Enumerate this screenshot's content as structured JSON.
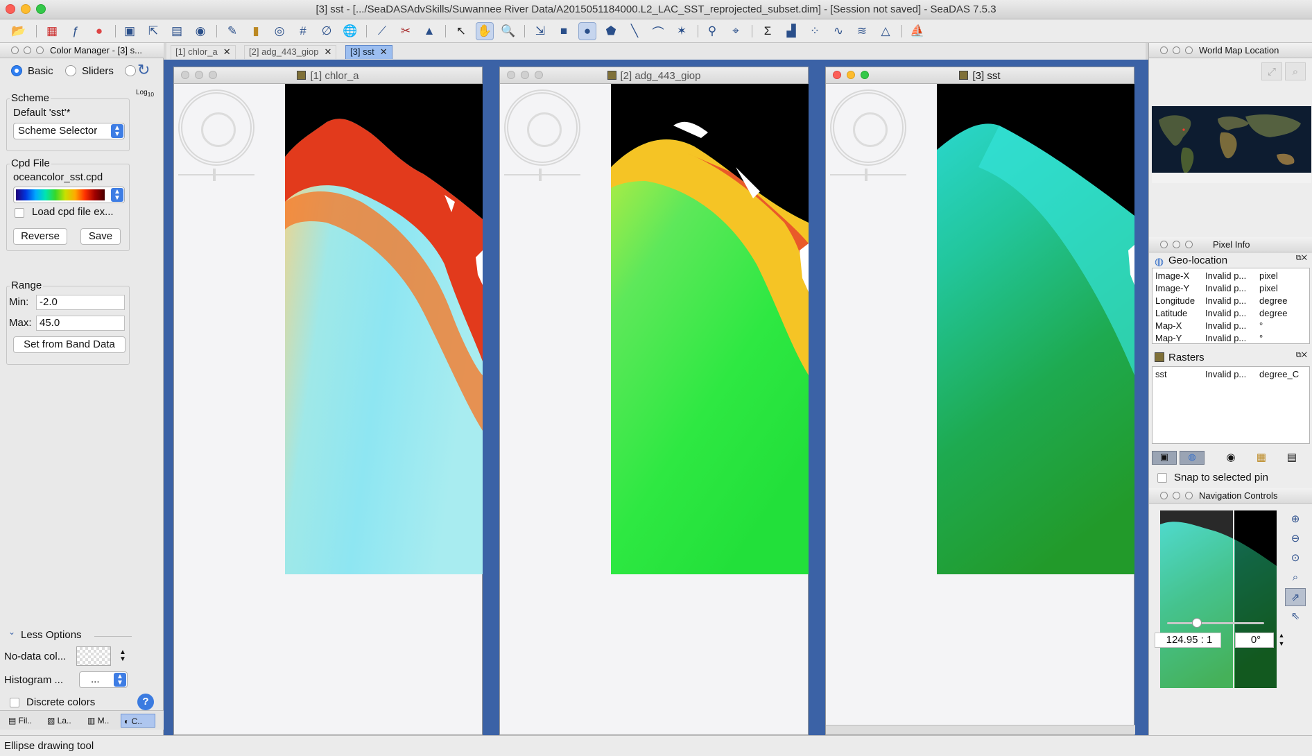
{
  "window": {
    "title": "[3] sst - [.../SeaDASAdvSkills/Suwannee River Data/A2015051184000.L2_LAC_SST_reprojected_subset.dim] - [Session not saved] - SeaDAS 7.5.3"
  },
  "toolbar": {
    "icons": [
      "open-folder-icon",
      "grid-icon",
      "band-maths-icon",
      "rgb-icon",
      "layers-icon",
      "export-icon",
      "mosaic-icon",
      "world-view-icon",
      "wand-icon",
      "range-icon",
      "contour-icon",
      "graticule-icon",
      "no-data-icon",
      "globe-icon",
      "pencil-icon",
      "tool-icon",
      "terrain-icon",
      "select-icon",
      "pan-icon",
      "zoom-icon",
      "pin-icon",
      "rectangle-icon",
      "ellipse-icon",
      "polygon-icon",
      "line-icon",
      "polyline-icon",
      "magic-icon",
      "pin-placer-icon",
      "gcp-icon",
      "statistics-icon",
      "histogram-icon",
      "scatter-icon",
      "profile-icon",
      "spectrum-icon",
      "info-icon",
      "ship-icon"
    ]
  },
  "color_manager": {
    "title": "Color Manager - [3] s...",
    "mode_basic": "Basic",
    "mode_sliders": "Sliders",
    "log_label": "Log",
    "log_sub": "10",
    "scheme": {
      "group_title": "Scheme",
      "default_label": "Default 'sst'*",
      "selector_value": "Scheme Selector"
    },
    "cpd": {
      "group_title": "Cpd File",
      "filename": "oceancolor_sst.cpd",
      "load_label": "Load cpd file ex...",
      "reverse": "Reverse",
      "save": "Save"
    },
    "range": {
      "group_title": "Range",
      "min_label": "Min:",
      "min_value": "-2.0",
      "max_label": "Max:",
      "max_value": "45.0",
      "set_button": "Set from Band Data"
    },
    "less_options": "Less Options",
    "no_data_label": "No-data col...",
    "histogram_label": "Histogram ...",
    "histogram_value": "...",
    "discrete_label": "Discrete colors",
    "bottom_tabs": [
      "Fil..",
      "La..",
      "M..",
      "C.."
    ]
  },
  "doc_tabs": [
    {
      "label": "[1] chlor_a",
      "close": "✕"
    },
    {
      "label": "[2] adg_443_giop",
      "close": "✕"
    },
    {
      "label": "[3] sst",
      "close": "✕"
    }
  ],
  "image_windows": [
    {
      "title": "[1] chlor_a"
    },
    {
      "title": "[2] adg_443_giop"
    },
    {
      "title": "[3] sst"
    }
  ],
  "right_panels": {
    "world_map_title": "World Map Location",
    "pixel_info_title": "Pixel Info",
    "geo_location_title": "Geo-location",
    "geo_rows": [
      {
        "name": "Image-X",
        "value": "Invalid p...",
        "unit": "pixel"
      },
      {
        "name": "Image-Y",
        "value": "Invalid p...",
        "unit": "pixel"
      },
      {
        "name": "Longitude",
        "value": "Invalid p...",
        "unit": "degree"
      },
      {
        "name": "Latitude",
        "value": "Invalid p...",
        "unit": "degree"
      },
      {
        "name": "Map-X",
        "value": "Invalid p...",
        "unit": "°"
      },
      {
        "name": "Map-Y",
        "value": "Invalid p...",
        "unit": "°"
      }
    ],
    "rasters_title": "Rasters",
    "raster_rows": [
      {
        "name": "sst",
        "value": "Invalid p...",
        "unit": "degree_C"
      }
    ],
    "snap_label": "Snap to selected pin",
    "navigation_title": "Navigation Controls",
    "zoom_value": "124.95 : 1",
    "rotation_value": "0°"
  },
  "status": {
    "text": "Ellipse drawing tool"
  }
}
